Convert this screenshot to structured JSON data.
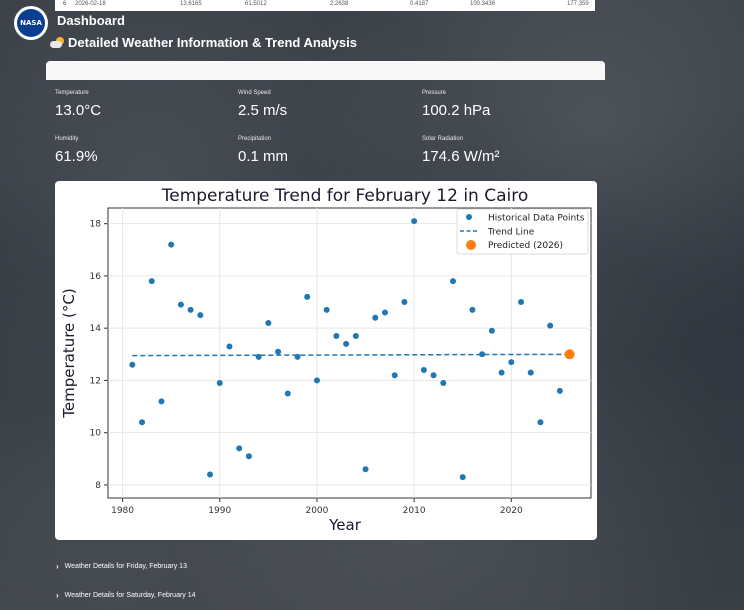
{
  "top_row": {
    "cells": [
      "6",
      "2026-02-18",
      "13.6165",
      "61.5012",
      "2.2638",
      "0.4187",
      "100.3436",
      "177.359"
    ]
  },
  "header": {
    "logo_text": "NASA",
    "dashboard_label": "Dashboard",
    "section_title": "Detailed Weather Information & Trend Analysis",
    "icon": "sun-behind-cloud-icon"
  },
  "metrics": [
    {
      "label": "Temperature",
      "value": "13.0°C"
    },
    {
      "label": "Wind Speed",
      "value": "2.5 m/s"
    },
    {
      "label": "Pressure",
      "value": "100.2 hPa"
    },
    {
      "label": "Humidity",
      "value": "61.9%"
    },
    {
      "label": "Precipitation",
      "value": "0.1 mm"
    },
    {
      "label": "Solar Radiation",
      "value": "174.6 W/m²"
    }
  ],
  "chart_data": {
    "type": "scatter",
    "title": "Temperature Trend for February 12 in Cairo",
    "xlabel": "Year",
    "ylabel": "Temperature (°C)",
    "xlim": [
      1978.5,
      2028.2
    ],
    "ylim": [
      7.5,
      18.6
    ],
    "xticks": [
      1980,
      1990,
      2000,
      2010,
      2020
    ],
    "yticks": [
      8,
      10,
      12,
      14,
      16,
      18
    ],
    "grid": true,
    "legend_position": "top-right",
    "series": [
      {
        "name": "Historical Data Points",
        "color": "#1f77b4",
        "x": [
          1981,
          1982,
          1983,
          1984,
          1985,
          1986,
          1987,
          1988,
          1989,
          1990,
          1991,
          1992,
          1993,
          1994,
          1995,
          1996,
          1997,
          1998,
          1999,
          2000,
          2001,
          2002,
          2003,
          2004,
          2005,
          2006,
          2007,
          2008,
          2009,
          2010,
          2011,
          2012,
          2013,
          2014,
          2015,
          2016,
          2017,
          2018,
          2019,
          2020,
          2021,
          2022,
          2023,
          2024,
          2025
        ],
        "y": [
          12.6,
          10.4,
          15.8,
          11.2,
          17.2,
          14.9,
          14.7,
          14.5,
          8.4,
          11.9,
          13.3,
          9.4,
          9.1,
          12.9,
          14.2,
          13.1,
          11.5,
          12.9,
          15.2,
          12.0,
          14.7,
          13.7,
          13.4,
          13.7,
          8.6,
          14.4,
          14.6,
          12.2,
          15.0,
          18.1,
          12.4,
          12.2,
          11.9,
          15.8,
          8.3,
          14.7,
          13.0,
          13.9,
          12.3,
          12.7,
          15.0,
          12.3,
          10.4,
          14.1,
          11.6
        ]
      },
      {
        "name": "Trend Line",
        "color": "#1f77b4",
        "style": "dashed",
        "x": [
          1981,
          2026
        ],
        "y": [
          12.95,
          13.0
        ]
      },
      {
        "name": "Predicted (2026)",
        "color": "#ff7f0e",
        "x": [
          2026
        ],
        "y": [
          13.0
        ]
      }
    ]
  },
  "expanders": [
    {
      "label": "Weather Details for Friday, February 13"
    },
    {
      "label": "Weather Details for Saturday, February 14"
    }
  ]
}
